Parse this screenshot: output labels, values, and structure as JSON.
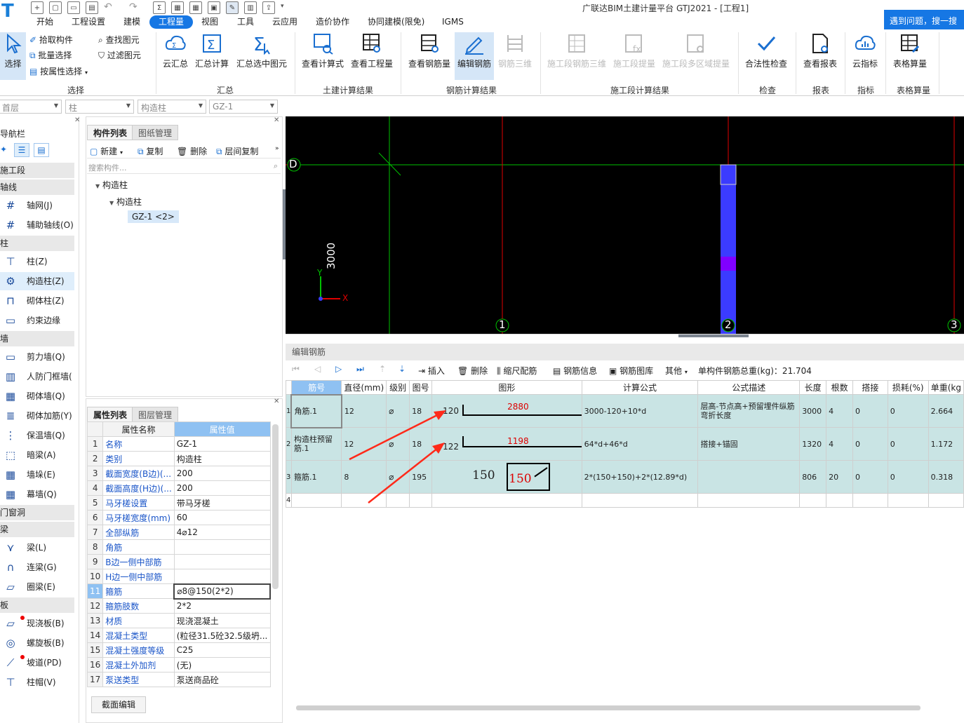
{
  "app": {
    "title": "广联达BIM土建计量平台 GTJ2021 - [工程1]",
    "help": "遇到问题，搜一搜"
  },
  "menu": [
    "开始",
    "工程设置",
    "建模",
    "工程量",
    "视图",
    "工具",
    "云应用",
    "造价协作",
    "协同建模(限免)",
    "IGMS"
  ],
  "ribbon": {
    "select": {
      "label": "选择",
      "pick": "拾取构件",
      "batch": "批量选择",
      "byattr": "按属性选择",
      "find": "查找图元",
      "filter": "过滤图元"
    },
    "summary": {
      "group": "汇总",
      "cloud": "云汇总",
      "calc": "汇总计算",
      "calcsel": "汇总选中图元"
    },
    "civil": {
      "group": "土建计算结果",
      "formula": "查看计算式",
      "quantity": "查看工程量"
    },
    "rebar": {
      "group": "钢筋计算结果",
      "view": "查看钢筋量",
      "edit": "编辑钢筋",
      "r3d": "钢筋三维"
    },
    "stage": {
      "group": "施工段计算结果",
      "s3d": "施工段钢筋三维",
      "extract": "施工段提量",
      "multi": "施工段多区域提量"
    },
    "check": {
      "group": "检查",
      "legal": "合法性检查"
    },
    "report": {
      "group": "报表",
      "view": "查看报表"
    },
    "index": {
      "group": "指标",
      "cloud": "云指标"
    },
    "table": {
      "group": "表格算量",
      "calc": "表格算量"
    }
  },
  "filters": [
    "首层",
    "柱",
    "构造柱",
    "GZ-1"
  ],
  "nav": {
    "title": "导航栏",
    "sections": [
      {
        "head": "施工段"
      },
      {
        "head": "轴线",
        "items": [
          "轴网(J)",
          "辅助轴线(O)"
        ]
      },
      {
        "head": "柱",
        "items": [
          "柱(Z)",
          "构造柱(Z)",
          "砌体柱(Z)",
          "约束边缘非..."
        ]
      },
      {
        "head": "墙",
        "items": [
          "剪力墙(Q)",
          "人防门框墙(",
          "砌体墙(Q)",
          "砌体加筋(Y)",
          "保温墙(Q)",
          "暗梁(A)",
          "墙垛(E)",
          "幕墙(Q)"
        ]
      },
      {
        "head": "门窗洞"
      },
      {
        "head": "梁",
        "items": [
          "梁(L)",
          "连梁(G)",
          "圈梁(E)"
        ]
      },
      {
        "head": "板",
        "items": [
          "现浇板(B)",
          "螺旋板(B)",
          "坡道(PD)",
          "柱帽(V)"
        ]
      }
    ]
  },
  "complist": {
    "tabs": [
      "构件列表",
      "图纸管理"
    ],
    "toolbar": [
      "新建",
      "复制",
      "删除",
      "层间复制"
    ],
    "search": "搜索构件...",
    "tree": [
      "构造柱",
      "构造柱",
      "GZ-1 <2>"
    ]
  },
  "props": {
    "tabs": [
      "属性列表",
      "图层管理"
    ],
    "headers": [
      "属性名称",
      "属性值"
    ],
    "rows": [
      [
        "1",
        "名称",
        "GZ-1"
      ],
      [
        "2",
        "类别",
        "构造柱"
      ],
      [
        "3",
        "截面宽度(B边)(...",
        "200"
      ],
      [
        "4",
        "截面高度(H边)(...",
        "200"
      ],
      [
        "5",
        "马牙槎设置",
        "带马牙槎"
      ],
      [
        "6",
        "马牙槎宽度(mm)",
        "60"
      ],
      [
        "7",
        "全部纵筋",
        "4⌀12"
      ],
      [
        "8",
        "角筋",
        ""
      ],
      [
        "9",
        "B边一侧中部筋",
        ""
      ],
      [
        "10",
        "H边一侧中部筋",
        ""
      ],
      [
        "11",
        "箍筋",
        "⌀8@150(2*2)"
      ],
      [
        "12",
        "箍筋肢数",
        "2*2"
      ],
      [
        "13",
        "材质",
        "现浇混凝土"
      ],
      [
        "14",
        "混凝土类型",
        "(粒径31.5砼32.5级坍..."
      ],
      [
        "15",
        "混凝土强度等级",
        "C25"
      ],
      [
        "16",
        "混凝土外加剂",
        "(无)"
      ],
      [
        "17",
        "泵送类型",
        "泵送商品砼"
      ]
    ],
    "footer": "截面编辑"
  },
  "viewport": {
    "axis_d": "D",
    "axis_1": "1",
    "axis_2": "2",
    "axis_3": "3",
    "dim": "3000",
    "y": "Y",
    "x": "X"
  },
  "rebar": {
    "title": "编辑钢筋",
    "toolbar": [
      "插入",
      "删除",
      "缩尺配筋",
      "钢筋信息",
      "钢筋图库",
      "其他"
    ],
    "total": "单构件钢筋总重(kg)：21.704",
    "headers": [
      "筋号",
      "直径(mm)",
      "级别",
      "图号",
      "图形",
      "计算公式",
      "公式描述",
      "长度",
      "根数",
      "搭接",
      "损耗(%)",
      "单重(kg"
    ],
    "rows": [
      {
        "n": "1",
        "name": "角筋.1",
        "dia": "12",
        "grade": "⌀",
        "fig": "18",
        "left": "120",
        "mid": "2880",
        "formula": "3000-120+10*d",
        "desc": "层高-节点高+预留埋件纵筋弯折长度",
        "len": "3000",
        "count": "4",
        "lap": "0",
        "loss": "0",
        "w": "2.664"
      },
      {
        "n": "2",
        "name": "构造柱预留筋.1",
        "dia": "12",
        "grade": "⌀",
        "fig": "18",
        "left": "122",
        "mid": "1198",
        "formula": "64*d+46*d",
        "desc": "搭接+锚固",
        "len": "1320",
        "count": "4",
        "lap": "0",
        "loss": "0",
        "w": "1.172"
      },
      {
        "n": "3",
        "name": "箍筋.1",
        "dia": "8",
        "grade": "⌀",
        "fig": "195",
        "left": "150",
        "mid": "150",
        "formula": "2*(150+150)+2*(12.89*d)",
        "desc": "",
        "len": "806",
        "count": "20",
        "lap": "0",
        "loss": "0",
        "w": "0.318"
      },
      {
        "n": "4"
      }
    ]
  },
  "colors": {
    "accent": "#1677e4",
    "row": "#c9e4e4",
    "column": "#3b3bff",
    "grid_red": "#e00000",
    "grid_green": "#00c000",
    "arrow": "#ff2a1a"
  }
}
